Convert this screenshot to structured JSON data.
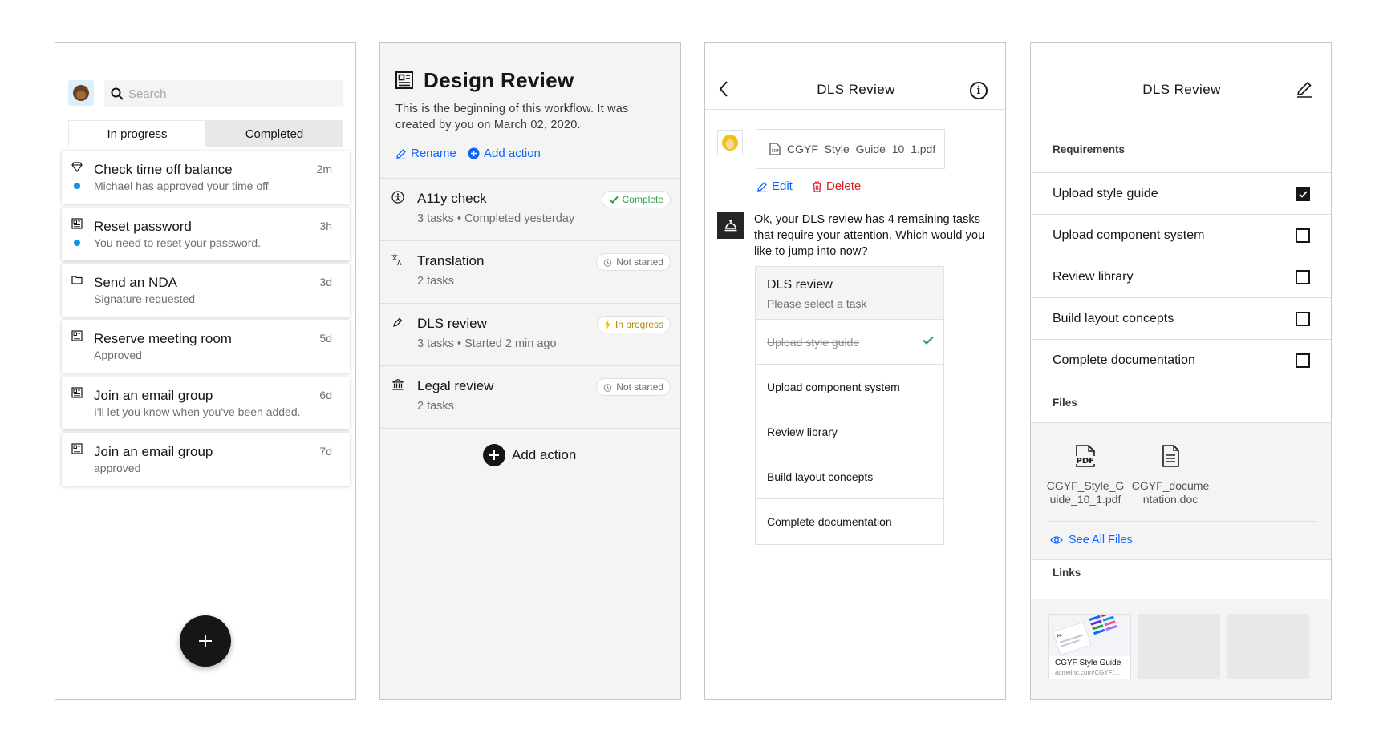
{
  "panel1": {
    "search": {
      "placeholder": "Search"
    },
    "tabs": {
      "in_progress": "In progress",
      "completed": "Completed"
    },
    "cards": [
      {
        "icon": "diamond-icon",
        "title": "Check time off balance",
        "subtitle": "Michael has approved your time off.",
        "time": "2m",
        "unread": true
      },
      {
        "icon": "form-icon",
        "title": "Reset password",
        "subtitle": "You need to reset your password.",
        "time": "3h",
        "unread": true
      },
      {
        "icon": "folder-icon",
        "title": "Send an NDA",
        "subtitle": "Signature requested",
        "time": "3d",
        "unread": false
      },
      {
        "icon": "form-icon",
        "title": "Reserve meeting room",
        "subtitle": "Approved",
        "time": "5d",
        "unread": false
      },
      {
        "icon": "form-icon",
        "title": "Join an email group",
        "subtitle": "I'll let you know when you've been added.",
        "time": "6d",
        "unread": false
      },
      {
        "icon": "form-icon",
        "title": "Join an email group",
        "subtitle": "approved",
        "time": "7d",
        "unread": false
      }
    ],
    "fab_icon": "add-icon"
  },
  "panel2": {
    "title": "Design Review",
    "description": "This is the beginning of this workflow. It was created by you on March 02, 2020.",
    "rename_label": "Rename",
    "add_action_link": "Add action",
    "workflows": [
      {
        "icon": "accessibility-icon",
        "title": "A11y check",
        "meta": "3 tasks • Completed yesterday",
        "status": "Complete",
        "status_color": "#24a148"
      },
      {
        "icon": "translate-icon",
        "title": "Translation",
        "meta": "2 tasks",
        "status": "Not started",
        "status_color": "#6f6f6f"
      },
      {
        "icon": "pen-icon",
        "title": "DLS review",
        "meta": "3 tasks • Started 2 min ago",
        "status": "In progress",
        "status_color": "#f1c21b"
      },
      {
        "icon": "bank-icon",
        "title": "Legal review",
        "meta": "2 tasks",
        "status": "Not started",
        "status_color": "#6f6f6f"
      }
    ],
    "add_action_button": "Add action"
  },
  "panel3": {
    "title": "DLS Review",
    "file_name": "CGYF_Style_Guide_10_1.pdf",
    "edit_label": "Edit",
    "delete_label": "Delete",
    "bot_message": "Ok, your DLS review has 4 remaining tasks that require your attention. Which would you like to jump into now?",
    "task_box": {
      "title": "DLS review",
      "subtitle": "Please select a task",
      "items": [
        {
          "label": "Upload style guide",
          "done": true
        },
        {
          "label": "Upload component system",
          "done": false
        },
        {
          "label": "Review library",
          "done": false
        },
        {
          "label": "Build layout concepts",
          "done": false
        },
        {
          "label": "Complete documentation",
          "done": false
        }
      ]
    }
  },
  "panel4": {
    "title": "DLS Review",
    "requirements_label": "Requirements",
    "requirements": [
      {
        "label": "Upload style guide",
        "checked": true
      },
      {
        "label": "Upload component system",
        "checked": false
      },
      {
        "label": "Review library",
        "checked": false
      },
      {
        "label": "Build layout concepts",
        "checked": false
      },
      {
        "label": "Complete documentation",
        "checked": false
      }
    ],
    "files_label": "Files",
    "files": [
      {
        "name": "CGYF_Style_Guide_10_1.pdf",
        "icon": "pdf-icon"
      },
      {
        "name": "CGYF_documentation.doc",
        "icon": "document-icon"
      }
    ],
    "see_all": "See All Files",
    "links_label": "Links",
    "links": [
      {
        "title": "CGYF Style Guide",
        "url": "acmeinc.com/CGYF/..."
      }
    ]
  },
  "colors": {
    "accent": "#0f62fe",
    "danger": "#da1e28",
    "success": "#24a148",
    "warning": "#f1c21b",
    "unread_dot": "#1192e8"
  }
}
